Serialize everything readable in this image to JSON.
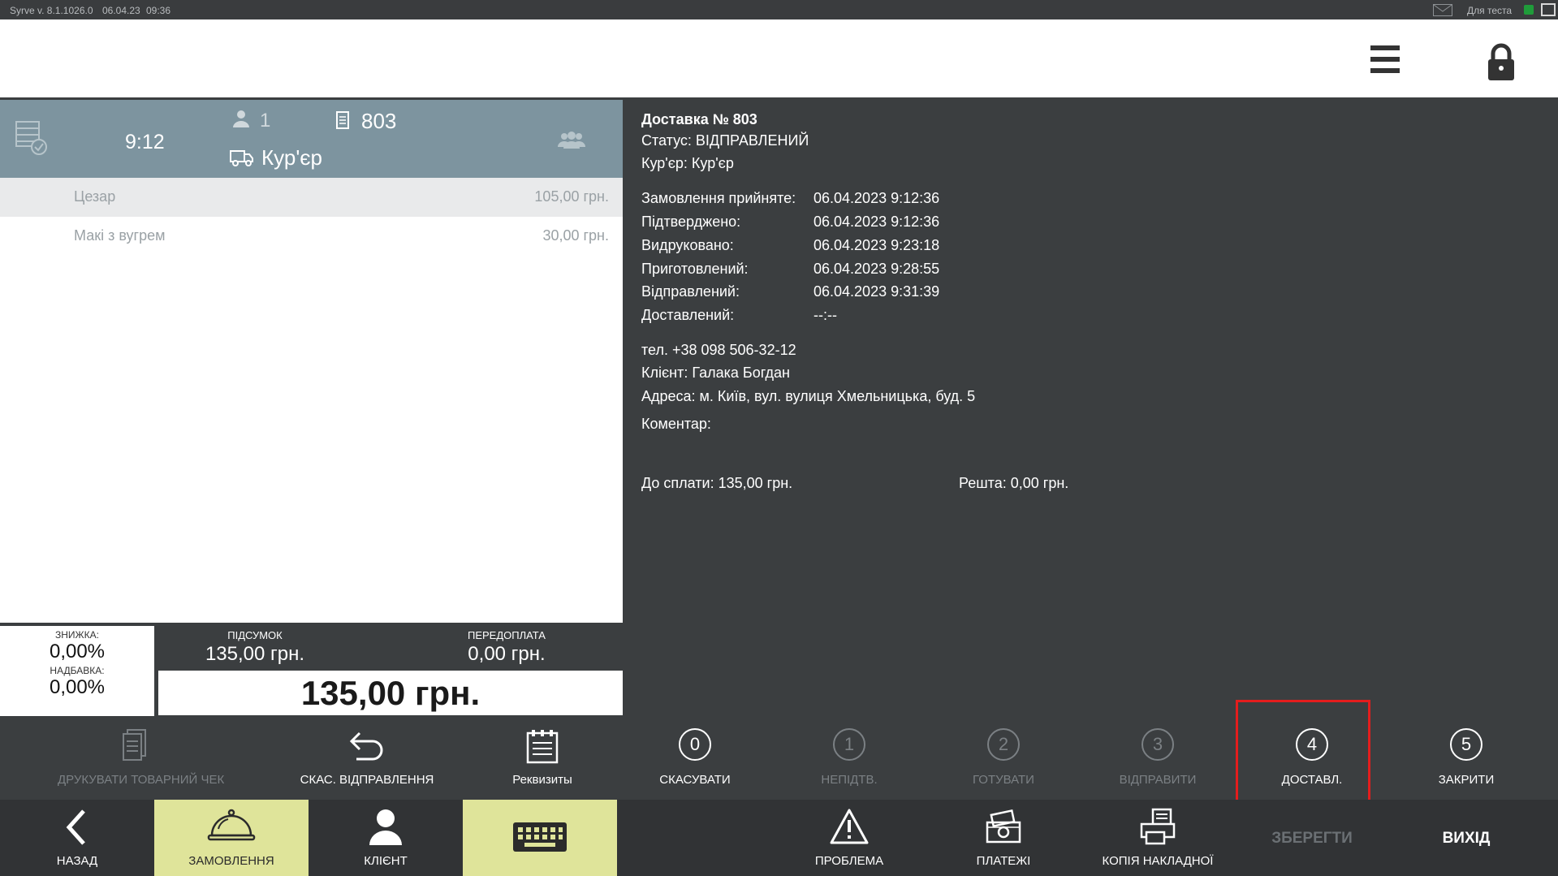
{
  "system_bar": {
    "version": "Syrve v. 8.1.1026.0",
    "date": "06.04.23",
    "time": "09:36",
    "environment": "Для теста"
  },
  "order_header": {
    "time": "9:12",
    "guests": "1",
    "order_number": "803",
    "order_type": "Кур'єр"
  },
  "items": [
    {
      "name": "Цезар",
      "price": "105,00 грн."
    },
    {
      "name": "Макі з вугрем",
      "price": "30,00 грн."
    }
  ],
  "totals": {
    "discount_label": "ЗНИЖКА:",
    "discount_value": "0,00%",
    "markup_label": "НАДБАВКА:",
    "markup_value": "0,00%",
    "subtotal_label": "ПІДСУМОК",
    "subtotal_value": "135,00 грн.",
    "prepay_label": "ПЕРЕДОПЛАТА",
    "prepay_value": "0,00 грн.",
    "total_value": "135,00 грн."
  },
  "delivery": {
    "title": "Доставка № 803",
    "status": "Статус: ВІДПРАВЛЕНИЙ",
    "courier": "Кур'єр: Кур'єр",
    "timeline": [
      {
        "label": "Замовлення прийняте:",
        "value": "06.04.2023 9:12:36"
      },
      {
        "label": "Підтверджено:",
        "value": "06.04.2023 9:12:36"
      },
      {
        "label": "Видруковано:",
        "value": "06.04.2023 9:23:18"
      },
      {
        "label": "Приготовлений:",
        "value": "06.04.2023 9:28:55"
      },
      {
        "label": "Відправлений:",
        "value": "06.04.2023 9:31:39"
      },
      {
        "label": "Доставлений:",
        "value": "--:--"
      }
    ],
    "phone": "тел. +38 098 506-32-12",
    "client": "Клієнт: Галака Богдан",
    "address": "Адреса: м. Київ, вул. вулиця Хмельницька, буд. 5",
    "comment": "Коментар:",
    "to_pay": "До сплати:  135,00 грн.",
    "change": "Решта:  0,00 грн."
  },
  "actions": {
    "print_receipt": "ДРУКУВАТИ ТОВАРНИЙ ЧЕК",
    "cancel_send": "СКАС. ВІДПРАВЛЕННЯ",
    "requisites": "Реквизиты",
    "status_steps": [
      {
        "num": "0",
        "label": "СКАСУВАТИ"
      },
      {
        "num": "1",
        "label": "НЕПІДТВ."
      },
      {
        "num": "2",
        "label": "ГОТУВАТИ"
      },
      {
        "num": "3",
        "label": "ВІДПРАВИТИ"
      },
      {
        "num": "4",
        "label": "ДОСТАВЛ."
      },
      {
        "num": "5",
        "label": "ЗАКРИТИ"
      }
    ]
  },
  "nav": {
    "back": "НАЗАД",
    "orders": "ЗАМОВЛЕННЯ",
    "client": "КЛІЄНТ",
    "problem": "ПРОБЛЕМА",
    "payments": "ПЛАТЕЖІ",
    "invoice_copy": "КОПІЯ НАКЛАДНОЇ",
    "save": "ЗБЕРЕГТИ",
    "exit": "ВИХІД"
  },
  "colors": {
    "background": "#3b3e40",
    "order_header": "#7d949f",
    "active_tab": "#dfe49a",
    "highlight": "#e41d1d"
  },
  "icons": {
    "menu": "hamburger-icon",
    "lock": "lock-icon",
    "guests": "person-icon",
    "order_number": "receipt-icon",
    "courier": "truck-icon",
    "group": "group-icon"
  }
}
